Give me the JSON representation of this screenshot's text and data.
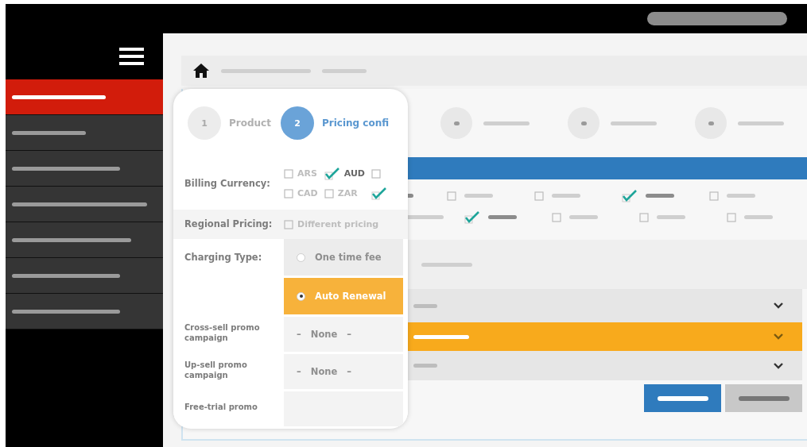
{
  "sidebar": {
    "items": [
      {
        "selected": true
      },
      {
        "selected": false
      },
      {
        "selected": false
      },
      {
        "selected": false
      },
      {
        "selected": false
      },
      {
        "selected": false
      },
      {
        "selected": false
      }
    ]
  },
  "option_grid": [
    [
      {
        "checked": false
      },
      {
        "checked": false
      },
      {
        "checked": true
      },
      {
        "checked": false
      }
    ],
    [
      {
        "checked": true
      },
      {
        "checked": false
      },
      {
        "checked": false
      },
      {
        "checked": false
      }
    ]
  ],
  "dropdowns": [
    {
      "selected": false
    },
    {
      "selected": true
    },
    {
      "selected": false
    }
  ],
  "popup": {
    "steps": [
      {
        "number": "1",
        "label": "Product",
        "selected": false
      },
      {
        "number": "2",
        "label": "Pricing confi",
        "selected": true
      }
    ],
    "fields": [
      {
        "kind": "checkboxes",
        "label": "Billing Currency:",
        "options": [
          {
            "label": "ARS",
            "checked": false
          },
          {
            "label": "AUD",
            "checked": true
          },
          {
            "checked": false
          },
          {
            "label": "CAD",
            "checked": false
          },
          {
            "label": "ZAR",
            "checked": false
          },
          {
            "checked": true
          }
        ]
      },
      {
        "kind": "checkboxes",
        "label": "Regional Pricing:",
        "options": [
          {
            "label": "Different pricing",
            "checked": false
          }
        ]
      },
      {
        "kind": "radios",
        "label": "Charging Type:",
        "options": [
          {
            "label": "One time fee",
            "selected": false
          },
          {
            "label": "Auto Renewal",
            "selected": true
          }
        ]
      },
      {
        "kind": "select",
        "label": "Cross-sell promo campaign",
        "value": "– None –"
      },
      {
        "kind": "select",
        "label": "Up-sell promo campaign",
        "value": "– None –"
      },
      {
        "kind": "select",
        "label": "Free-trial promo"
      }
    ]
  }
}
